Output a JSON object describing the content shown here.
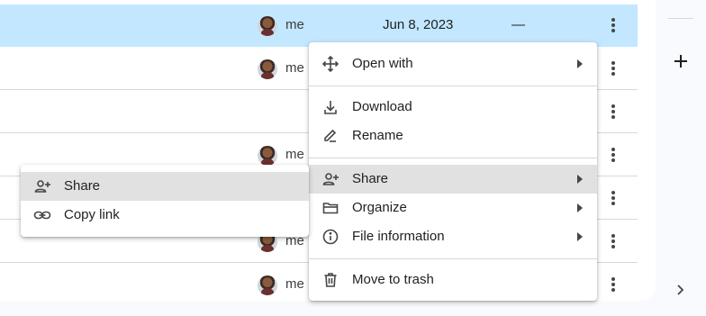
{
  "rows": [
    {
      "owner": "me",
      "date": "Jun 8, 2023",
      "size": "—",
      "selected": true
    },
    {
      "owner": "me",
      "date": "",
      "size": ""
    },
    {
      "owner": "",
      "date": "",
      "size": ""
    },
    {
      "owner": "me",
      "date": "",
      "size": ""
    },
    {
      "owner": "",
      "date": "",
      "size": ""
    },
    {
      "owner": "me",
      "date": "",
      "size": ""
    },
    {
      "owner": "me",
      "date": "",
      "size": ""
    }
  ],
  "context_menu": {
    "items": [
      {
        "label": "Open with",
        "icon": "open-with-icon"
      },
      {
        "label": "Download",
        "icon": "download-icon"
      },
      {
        "label": "Rename",
        "icon": "rename-icon"
      },
      {
        "label": "Share",
        "icon": "share-icon"
      },
      {
        "label": "Organize",
        "icon": "folder-icon"
      },
      {
        "label": "File information",
        "icon": "info-icon"
      },
      {
        "label": "Move to trash",
        "icon": "trash-icon"
      }
    ]
  },
  "share_submenu": {
    "items": [
      {
        "label": "Share",
        "icon": "person-add-icon"
      },
      {
        "label": "Copy link",
        "icon": "link-icon"
      }
    ]
  },
  "colors": {
    "selected_row": "#c2e7ff",
    "highlight": "#e1e1e1",
    "page_bg": "#f8fafd"
  }
}
